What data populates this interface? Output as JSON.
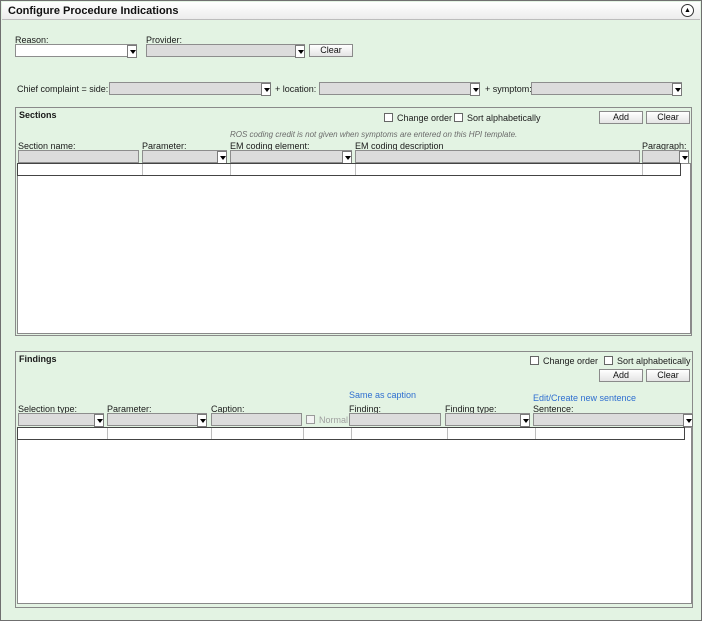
{
  "window": {
    "title": "Configure Procedure Indications"
  },
  "top": {
    "reason_label": "Reason:",
    "provider_label": "Provider:",
    "clear_label": "Clear",
    "chief_complaint_label": "Chief complaint = side:",
    "location_label": "+ location:",
    "symptom_label": "+ symptom:"
  },
  "sections": {
    "title": "Sections",
    "change_order_label": "Change order",
    "sort_alpha_label": "Sort alphabetically",
    "add_label": "Add",
    "clear_label": "Clear",
    "note": "ROS coding credit is not given when symptoms are entered on this HPI template.",
    "columns": {
      "section_name": "Section name:",
      "parameter": "Parameter:",
      "em_coding_element": "EM coding element:",
      "em_coding_description": "EM coding description",
      "paragraph": "Paragraph:"
    }
  },
  "findings": {
    "title": "Findings",
    "change_order_label": "Change order",
    "sort_alpha_label": "Sort alphabetically",
    "add_label": "Add",
    "clear_label": "Clear",
    "same_as_caption_link": "Same as caption",
    "edit_sentence_link": "Edit/Create new sentence",
    "normal_label": "Normal",
    "columns": {
      "selection_type": "Selection type:",
      "parameter": "Parameter:",
      "caption": "Caption:",
      "finding": "Finding:",
      "finding_type": "Finding type:",
      "sentence": "Sentence:"
    }
  }
}
